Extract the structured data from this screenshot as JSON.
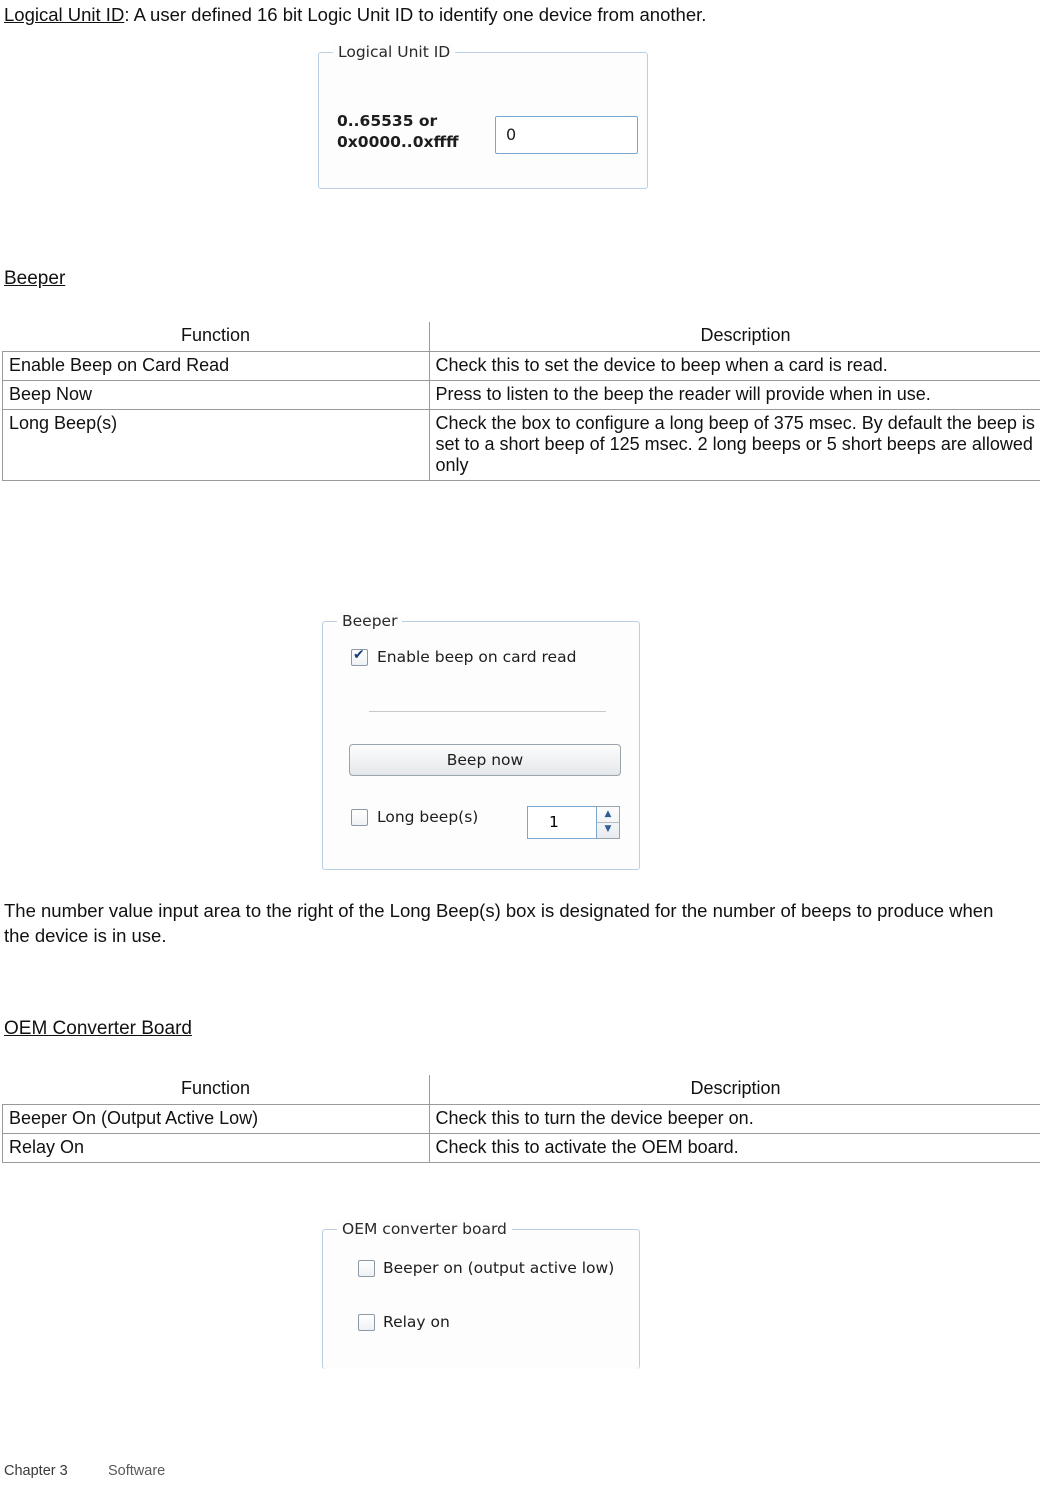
{
  "intro": {
    "term": "Logical Unit ID",
    "text": ": A user  defined  16 bit Logic Unit ID to identify one device from another."
  },
  "figures": {
    "logical_unit_id": {
      "group_title": "Logical Unit ID",
      "range_label": "0..65535 or\n0x0000..0xffff",
      "input_value": "0"
    },
    "beeper": {
      "group_title": "Beeper",
      "enable_beep_label": "Enable beep on card read",
      "enable_beep_checked": "checked",
      "beep_now_label": "Beep now",
      "long_beeps_label": "Long beep(s)",
      "long_beeps_checked": "unchecked",
      "spinner_value": "1",
      "spinner_up": "▲",
      "spinner_down": "▼"
    },
    "oem": {
      "group_title": "OEM converter board",
      "beeper_on_label": "Beeper on (output active low)",
      "relay_on_label": "Relay on"
    }
  },
  "sections": {
    "beeper_heading": "Beeper",
    "oem_heading": "OEM Converter Board"
  },
  "beeper_table": {
    "headers": [
      "Function",
      "Description"
    ],
    "rows": [
      {
        "function": "Enable Beep on Card Read",
        "description": "Check this to set the device to beep when a card is read."
      },
      {
        "function": "Beep Now",
        "description": "Press to listen to the beep the reader will provide when in use."
      },
      {
        "function": "Long Beep(s)",
        "description": "Check the box to configure  a long beep of 375 msec. By default the beep is set to a short beep of 125 msec. 2 long beeps or 5 short beeps are allowed only"
      }
    ]
  },
  "oem_table": {
    "headers": [
      "Function",
      "Description"
    ],
    "rows": [
      {
        "function": "Beeper On (Output Active Low)",
        "description": "Check this to turn the device beeper on."
      },
      {
        "function": "Relay On",
        "description": "Check this to activate the OEM board."
      }
    ]
  },
  "paragraphs": {
    "number_value": "The number  value input area to the right of the Long Beep(s) box is designated for the number of beeps to produce when the device is in use."
  },
  "footer": {
    "chapter": "Chapter 3",
    "section": "Software"
  }
}
